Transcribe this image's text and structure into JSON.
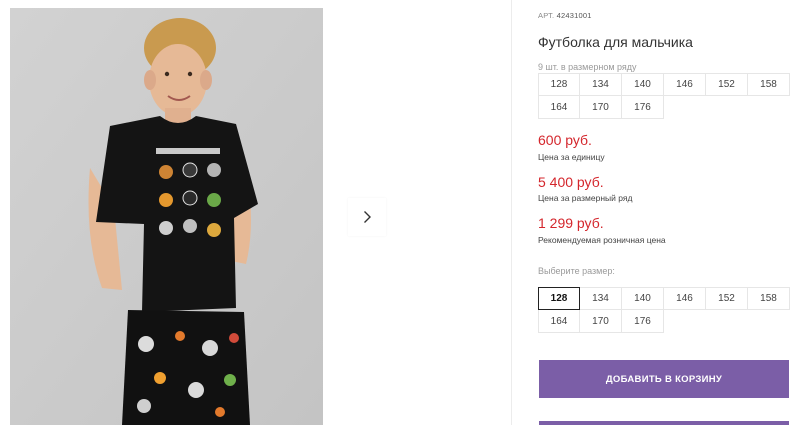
{
  "gallery": {
    "main_image": "boy-in-black-tshirt-photo",
    "next_icon": "chevron-right-icon"
  },
  "product": {
    "sku_label": "АРТ.",
    "sku_value": "42431001",
    "title": "Футболка для мальчика",
    "size_count": "9 шт. в размерном ряду",
    "size_range": [
      "128",
      "134",
      "140",
      "146",
      "152",
      "158",
      "164",
      "170",
      "176"
    ]
  },
  "prices": [
    {
      "value": "600 руб.",
      "label": "Цена за единицу"
    },
    {
      "value": "5 400 руб.",
      "label": "Цена за размерный ряд"
    },
    {
      "value": "1 299 руб.",
      "label": "Рекомендуемая розничная цена"
    }
  ],
  "size_select": {
    "label": "Выберите размер:",
    "options": [
      "128",
      "134",
      "140",
      "146",
      "152",
      "158",
      "164",
      "170",
      "176"
    ],
    "selected": "128"
  },
  "cart": {
    "add_label": "ДОБАВИТЬ В КОРЗИНУ"
  },
  "colors": {
    "price": "#d4262c",
    "button": "#7b5ea7"
  }
}
